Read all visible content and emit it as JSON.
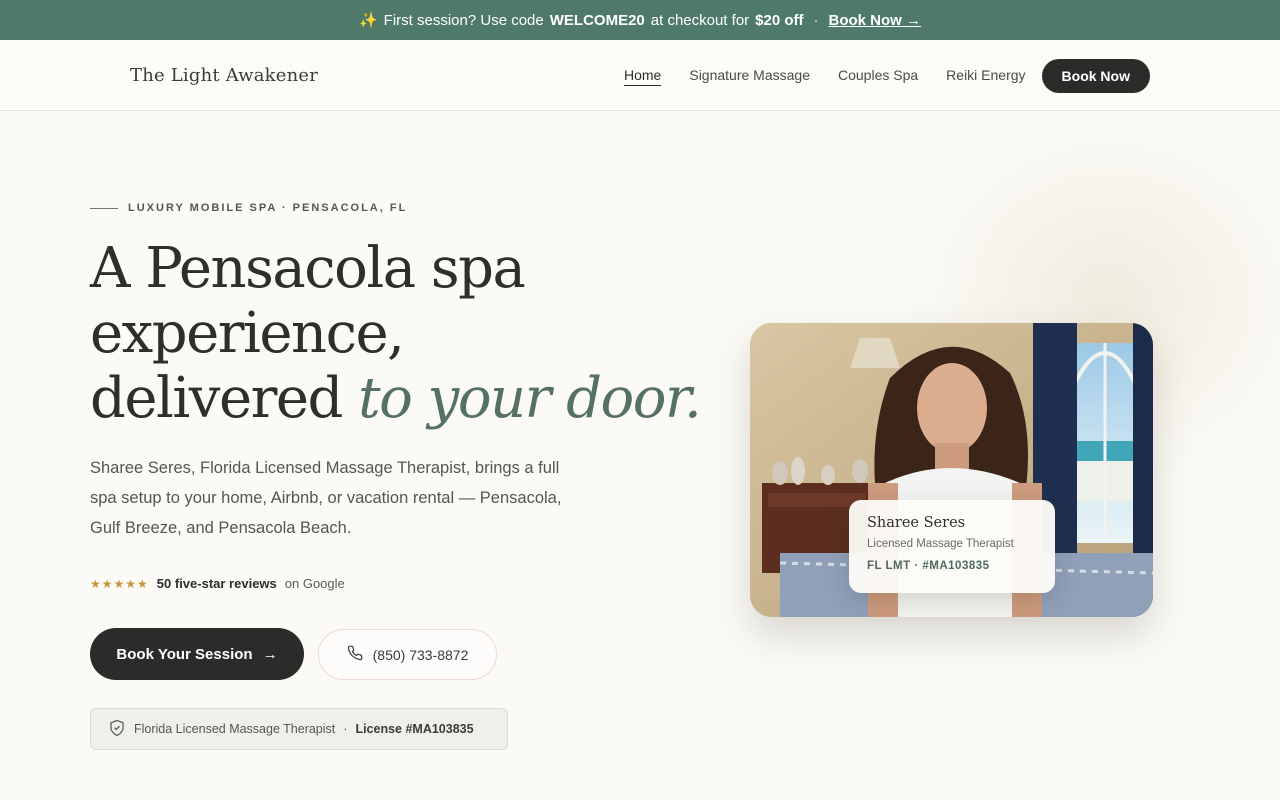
{
  "promo": {
    "emoji": "✨",
    "text_prefix": "First session? Use code",
    "code": "WELCOME20",
    "text_mid": "at checkout for",
    "amount": "$20 off",
    "separator": "·",
    "link_label": "Book Now →"
  },
  "header": {
    "brand": "The Light Awakener",
    "nav": [
      {
        "label": "Home",
        "active": true
      },
      {
        "label": "Signature Massage"
      },
      {
        "label": "Couples Spa"
      },
      {
        "label": "Reiki Energy"
      }
    ],
    "cta_label": "Book Now"
  },
  "hero": {
    "eyebrow": "LUXURY MOBILE SPA · PENSACOLA, FL",
    "headline_line1": "A Pensacola spa",
    "headline_line2": "experience,",
    "headline_line3_plain": "delivered",
    "headline_line3_accent": "to your door.",
    "lede": "Sharee Seres, Florida Licensed Massage Therapist, brings a full spa setup to your home, Airbnb, or vacation rental — Pensacola, Gulf Breeze, and Pensacola Beach.",
    "reviews": {
      "stars": "★★★★★",
      "count_label": "50 five-star reviews",
      "source": "on Google"
    },
    "primary_button": "Book Your Session",
    "primary_button_icon": "→",
    "phone_label": "(850) 733-8872",
    "license_badge": {
      "text": "Florida Licensed Massage Therapist",
      "separator": "·",
      "license": "License #MA103835"
    }
  },
  "profile_card": {
    "name": "Sharee Seres",
    "role": "Licensed Massage Therapist",
    "license": "FL LMT · #MA103835"
  },
  "colors": {
    "promo_bg": "#4f7a6a",
    "accent_text": "#557163",
    "dark_button": "#2b2c2a",
    "star": "#c6963c"
  }
}
